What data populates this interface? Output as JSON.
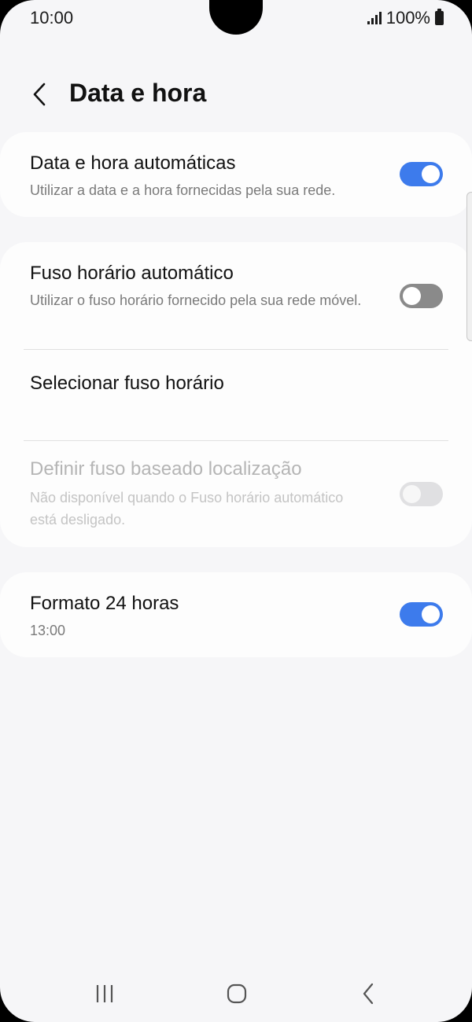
{
  "status_bar": {
    "time": "10:00",
    "battery": "100%",
    "icons": [
      "signal-icon",
      "battery-icon"
    ]
  },
  "header": {
    "title": "Data e hora",
    "back_icon": "chevron-left-icon"
  },
  "settings": {
    "auto_datetime": {
      "title": "Data e hora automáticas",
      "subtitle": "Utilizar a data e a hora fornecidas pela sua rede.",
      "enabled": true
    },
    "auto_timezone": {
      "title": "Fuso horário automático",
      "subtitle": "Utilizar o fuso horário fornecido pela sua rede móvel.",
      "enabled": false
    },
    "select_timezone": {
      "title": "Selecionar fuso horário"
    },
    "location_timezone": {
      "title": "Definir fuso baseado localização",
      "subtitle": "Não disponível quando o Fuso horário automático está desligado.",
      "enabled": false,
      "disabled": true
    },
    "format_24h": {
      "title": "Formato 24 horas",
      "subtitle": "13:00",
      "enabled": true
    }
  },
  "nav_bar": {
    "icons": [
      "recents-icon",
      "home-icon",
      "back-icon"
    ]
  },
  "colors": {
    "accent": "#3d7bec",
    "background": "#f6f6f8",
    "card": "#fdfdfd",
    "toggle_off": "#8a8a8a"
  }
}
